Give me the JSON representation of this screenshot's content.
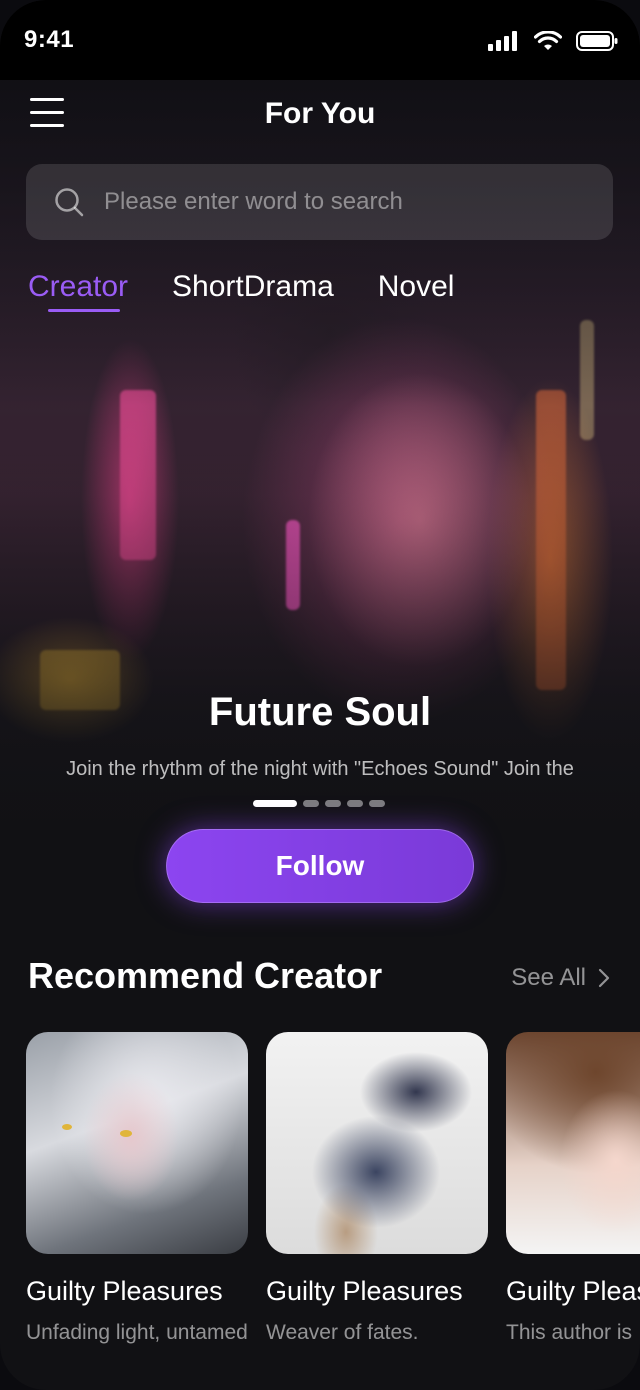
{
  "status_bar": {
    "time": "9:41"
  },
  "header": {
    "title": "For You"
  },
  "search": {
    "placeholder": "Please enter word to search"
  },
  "tabs": [
    {
      "label": "Creator",
      "active": true
    },
    {
      "label": "ShortDrama",
      "active": false
    },
    {
      "label": "Novel",
      "active": false
    }
  ],
  "hero": {
    "title": "Future Soul",
    "subtitle": "Join the rhythm of the night with \"Echoes Sound\" Join the",
    "carousel_pages": 5,
    "carousel_active": 1,
    "follow_label": "Follow"
  },
  "recommend": {
    "title": "Recommend Creator",
    "see_all": "See All",
    "creators": [
      {
        "name": "Guilty Pleasures",
        "desc": "Unfading light, untamed"
      },
      {
        "name": "Guilty Pleasures",
        "desc": "Weaver of fates."
      },
      {
        "name": "Guilty Pleasures",
        "desc": "This author is"
      }
    ]
  },
  "colors": {
    "accent": "#9a5cf5",
    "background": "#111114"
  }
}
